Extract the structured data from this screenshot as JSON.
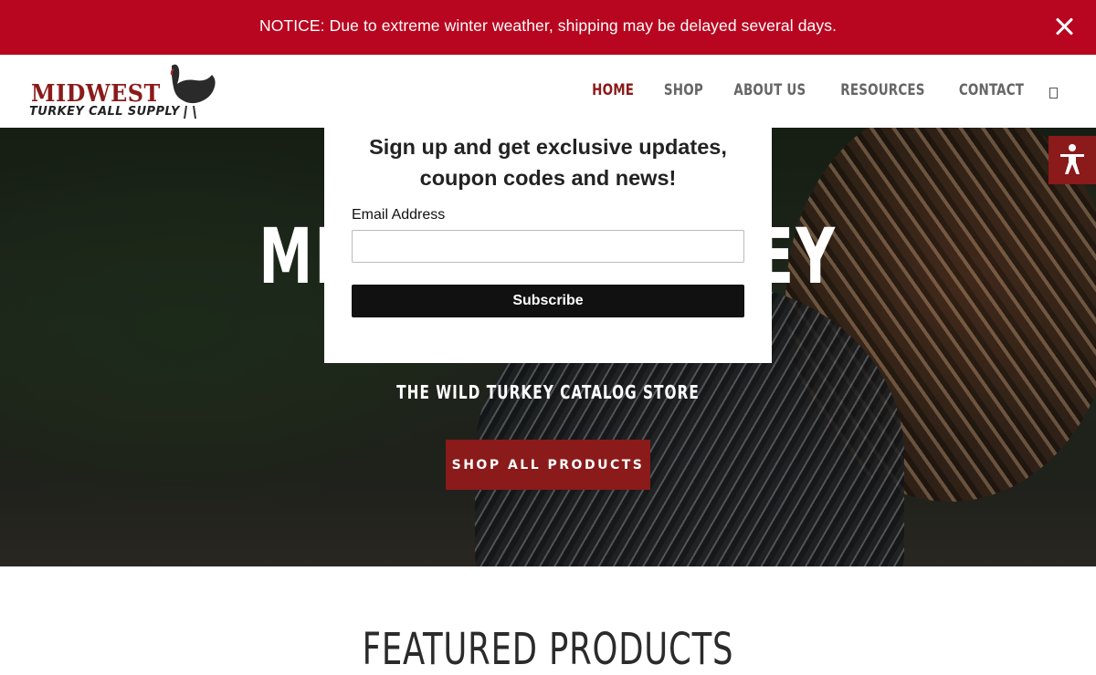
{
  "notice": {
    "text": "NOTICE: Due to extreme winter weather, shipping may be delayed several days."
  },
  "logo": {
    "line1": "MIDWEST",
    "line2": "TURKEY CALL SUPPLY"
  },
  "nav": {
    "items": [
      {
        "label": "HOME",
        "active": true
      },
      {
        "label": "SHOP",
        "active": false
      },
      {
        "label": "ABOUT US",
        "active": false
      },
      {
        "label": "RESOURCES",
        "active": false
      },
      {
        "label": "CONTACT",
        "active": false
      }
    ],
    "search_icon": "search-icon"
  },
  "hero": {
    "title": "MIDWEST TURKEY",
    "subtitle": "THE WILD TURKEY CATALOG STORE",
    "button_label": "SHOP ALL PRODUCTS"
  },
  "popup": {
    "heading_line1": "Sign up and get exclusive updates,",
    "heading_line2": "coupon codes and news!",
    "email_label": "Email Address",
    "email_value": "",
    "subscribe_label": "Subscribe"
  },
  "featured": {
    "title": "FEATURED PRODUCTS"
  },
  "colors": {
    "notice_bg": "#b80620",
    "brand_red": "#8b1a1a",
    "button_dark": "#111111"
  }
}
